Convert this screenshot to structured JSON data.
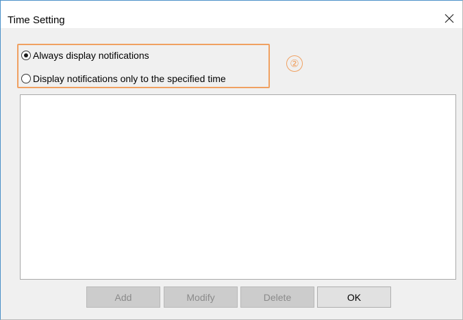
{
  "window": {
    "title": "Time Setting",
    "close_glyph": "✕"
  },
  "options": {
    "always_label": "Always display notifications",
    "specified_label": "Display notifications only to the specified time",
    "selected": "always"
  },
  "annotation": {
    "step_marker": "②",
    "color": "#f0a060"
  },
  "time_list": {
    "items": []
  },
  "buttons": {
    "add_label": "Add",
    "modify_label": "Modify",
    "delete_label": "Delete",
    "ok_label": "OK"
  }
}
